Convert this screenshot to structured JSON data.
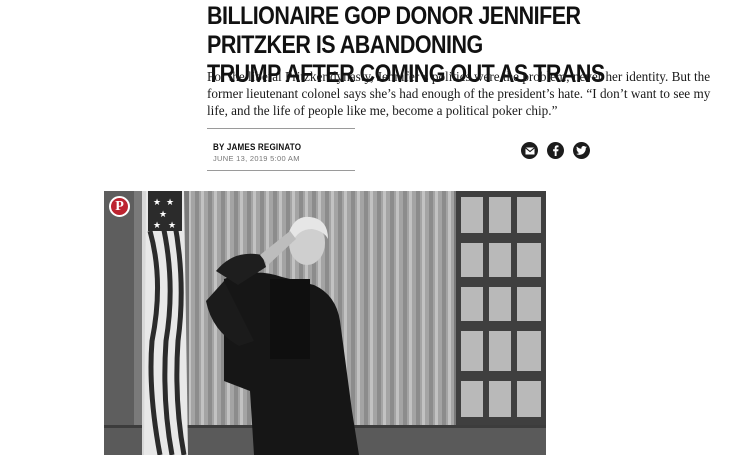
{
  "article": {
    "headline": "BILLIONAIRE GOP DONOR JENNIFER PRITZKER IS ABANDONING\nTRUMP AFTER COMING OUT AS TRANS",
    "dek": "For the liberal Pritzker dynasty, Jennifer’s politics were the problem, never her identity. But the former lieutenant colonel says she’s had enough of the president’s hate. “I don’t want to see my life, and the life of people like me, become a political poker chip.”",
    "byline": "BY JAMES REGINATO",
    "date": "JUNE 13, 2019 5:00 AM"
  },
  "share": {
    "icons": [
      "envelope-icon",
      "facebook-icon",
      "twitter-icon"
    ]
  },
  "photo": {
    "pin_label": "P",
    "subject": "black-and-white photo of a woman saluting in front of an American flag and draped window"
  },
  "colors": {
    "text": "#111111",
    "pinterest": "#bd2430",
    "share_icon_bg": "#1c1c1c"
  }
}
